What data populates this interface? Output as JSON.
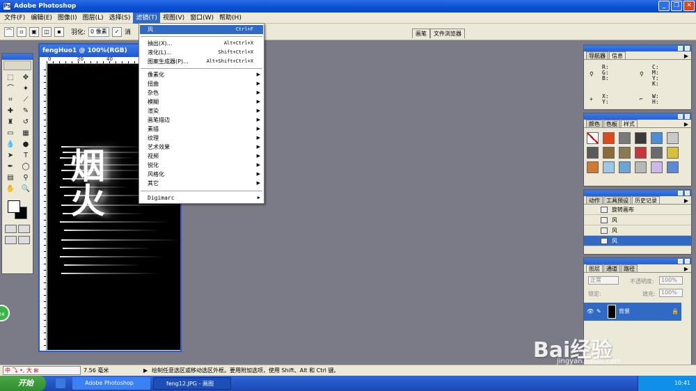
{
  "app": {
    "title": "Adobe Photoshop"
  },
  "menubar": [
    "文件(F)",
    "编辑(E)",
    "图像(I)",
    "图层(L)",
    "选择(S)",
    "滤镜(T)",
    "视图(V)",
    "窗口(W)",
    "帮助(H)"
  ],
  "options": {
    "feather_label": "羽化:",
    "feather_value": "0 像素",
    "antialias_label": "消"
  },
  "well_tabs": [
    "画笔",
    "文件浏览器"
  ],
  "document": {
    "title": "fengHuo1 @ 100%(RGB)",
    "ruler_nums": [
      "0",
      "20",
      "40"
    ]
  },
  "filter_menu": {
    "top": [
      {
        "label": "风",
        "shortcut": "Ctrl+F"
      }
    ],
    "group2": [
      {
        "label": "抽出(X)...",
        "shortcut": "Alt+Ctrl+X"
      },
      {
        "label": "液化(L)...",
        "shortcut": "Shift+Ctrl+X"
      },
      {
        "label": "图案生成器(P)...",
        "shortcut": "Alt+Shift+Ctrl+X"
      }
    ],
    "submenus": [
      "像素化",
      "扭曲",
      "杂色",
      "模糊",
      "渲染",
      "画笔描边",
      "素描",
      "纹理",
      "艺术效果",
      "视频",
      "锐化",
      "风格化",
      "其它"
    ],
    "bottom": [
      "Digimarc"
    ]
  },
  "navigator": {
    "tabs": [
      "导航器",
      "信息"
    ],
    "labels": {
      "rgb": "R:\nG:\nB:",
      "cmyk": "C:\nM:\nY:\nK:",
      "xy": "X:\nY:",
      "wh": "W:\nH:"
    }
  },
  "color_panel": {
    "tabs": [
      "颜色",
      "色板",
      "样式"
    ],
    "styles": [
      "#ffffff",
      "#d94b1c",
      "#7a7a7a",
      "#3a3a3a",
      "#4d8fd6",
      "#c9c9c9",
      "#5a5a5a",
      "#8b6b3a",
      "#8a7a52",
      "#c8363c",
      "#6b6b6b",
      "#d8c03a",
      "#d07a30",
      "#9cc8e8",
      "#6aa7d6",
      "#b8b8b8",
      "#cbb8e8",
      "#5a8ad6"
    ]
  },
  "history": {
    "tabs": [
      "动作",
      "工具预设",
      "历史记录"
    ],
    "items": [
      "旋转画布",
      "风",
      "风",
      "风"
    ]
  },
  "layers": {
    "tabs": [
      "图层",
      "通道",
      "路径"
    ],
    "blend": "正常",
    "opacity_label": "不透明度:",
    "opacity_value": "100%",
    "lock_label": "锁定:",
    "fill_label": "填充:",
    "fill_value": "100%",
    "layer_name": "背景"
  },
  "status": {
    "ime": "中 ⤵ •, 大 ⊞",
    "zoom": "7.56 毫米",
    "tip": "绘制任意选区或移动选区外框。要用附加选项，使用 Shift、Alt 和 Ctrl 键。"
  },
  "taskbar": {
    "start": "开始",
    "tasks": [
      "Adobe Photoshop",
      "feng12.JPG - 画图"
    ],
    "clock": "10:41"
  },
  "badge": "24",
  "watermark": {
    "brand": "Bai经验",
    "url": "jingyan.baidu.com"
  }
}
